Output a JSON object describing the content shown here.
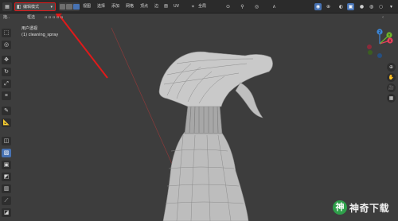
{
  "header": {
    "mode_label": "编辑模式",
    "menus": [
      "视图",
      "选择",
      "添加",
      "网格",
      "顶点",
      "边",
      "面",
      "UV"
    ],
    "transform_label": "全局"
  },
  "tool_header": {
    "items": [
      "拖..",
      "框选"
    ]
  },
  "viewport": {
    "view_name": "用户透视",
    "object_name": "(1) cleaning_spray"
  },
  "gizmo": {
    "axis_x": "X",
    "axis_y": "Y",
    "axis_z": "Z"
  },
  "colors": {
    "background": "#3d3d3d",
    "header": "#2b2b2b",
    "accent": "#4772b3",
    "annotation_arrow": "#e01a1a",
    "axis_x": "#e8415b",
    "axis_y": "#6fb52c",
    "axis_z": "#3d87d8"
  },
  "watermark": {
    "logo": "神",
    "text": "神奇下载"
  }
}
